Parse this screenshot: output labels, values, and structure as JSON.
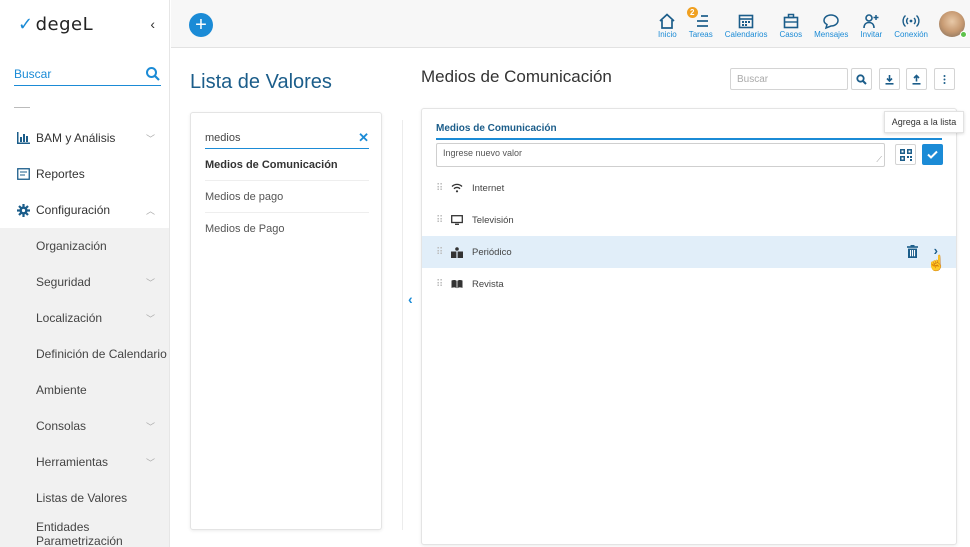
{
  "sidebar": {
    "logo_text": "degeL",
    "collapse_icon": "chevron-left-icon",
    "search_placeholder": "Buscar",
    "items": [
      {
        "label": "BAM y Análisis",
        "icon": "bar-chart-icon"
      },
      {
        "label": "Reportes",
        "icon": "report-icon"
      },
      {
        "label": "Configuración",
        "icon": "gear-icon"
      }
    ],
    "sub_items": [
      {
        "label": "Organización"
      },
      {
        "label": "Seguridad"
      },
      {
        "label": "Localización"
      },
      {
        "label": "Definición de Calendario"
      },
      {
        "label": "Ambiente"
      },
      {
        "label": "Consolas"
      },
      {
        "label": "Herramientas"
      },
      {
        "label": "Listas de Valores"
      },
      {
        "label": "Entidades Parametrización"
      }
    ]
  },
  "topbar": {
    "add_label": "+",
    "tasks_badge": "2",
    "icons": [
      {
        "label": "Inicio",
        "icon": "home-icon"
      },
      {
        "label": "Tareas",
        "icon": "tasks-icon"
      },
      {
        "label": "Calendarios",
        "icon": "calendar-icon"
      },
      {
        "label": "Casos",
        "icon": "briefcase-icon"
      },
      {
        "label": "Mensajes",
        "icon": "message-icon"
      },
      {
        "label": "Invitar",
        "icon": "add-user-icon"
      },
      {
        "label": "Conexión",
        "icon": "wifi-icon"
      }
    ]
  },
  "lista_valores": {
    "title": "Lista de Valores",
    "filter_value": "medios",
    "items": [
      {
        "label": "Medios de Comunicación",
        "active": true
      },
      {
        "label": "Medios de pago",
        "active": false
      },
      {
        "label": "Medios de Pago",
        "active": false
      }
    ]
  },
  "medios": {
    "title": "Medios de Comunicación",
    "search_placeholder": "Buscar",
    "field_label": "Medios de Comunicación",
    "input_placeholder": "Ingrese nuevo valor",
    "tooltip": "Agrega a la lista",
    "rows": [
      {
        "label": "Internet",
        "icon": "wifi-icon"
      },
      {
        "label": "Televisión",
        "icon": "monitor-icon"
      },
      {
        "label": "Periódico",
        "icon": "newspaper-icon",
        "highlighted": true
      },
      {
        "label": "Revista",
        "icon": "book-icon"
      }
    ]
  },
  "colors": {
    "accent": "#1b8bd6",
    "dark_accent": "#1b5d8a",
    "highlight_row": "#e1eef9"
  }
}
